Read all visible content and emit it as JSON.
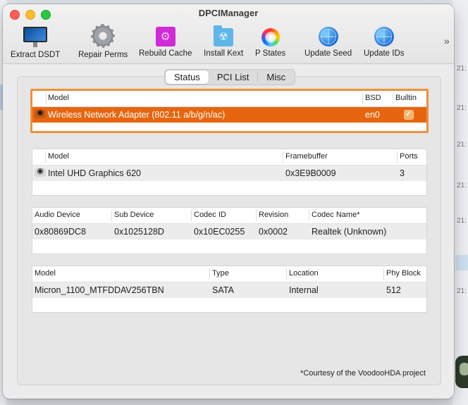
{
  "window": {
    "title": "DPCIManager"
  },
  "toolbar": [
    {
      "label": "Extract DSDT",
      "icon": "monitor-icon"
    },
    {
      "label": "Repair Perms",
      "icon": "gear-icon"
    },
    {
      "label": "Rebuild Cache",
      "icon": "cache-icon"
    },
    {
      "label": "Install Kext",
      "icon": "kext-folder-icon"
    },
    {
      "label": "P States",
      "icon": "color-wheel-icon"
    },
    {
      "label": "Update Seed",
      "icon": "globe-icon"
    },
    {
      "label": "Update IDs",
      "icon": "globe-icon"
    }
  ],
  "toolbar_overflow": "»",
  "tabs": [
    {
      "label": "Status",
      "active": true
    },
    {
      "label": "PCI List",
      "active": false
    },
    {
      "label": "Misc",
      "active": false
    }
  ],
  "network": {
    "headers": {
      "model": "Model",
      "bsd": "BSD",
      "builtin": "Builtin"
    },
    "rows": [
      {
        "model": "Wireless Network Adapter (802.11 a/b/g/n/ac)",
        "bsd": "en0",
        "builtin": true
      }
    ]
  },
  "graphics": {
    "headers": {
      "model": "Model",
      "framebuffer": "Framebuffer",
      "ports": "Ports"
    },
    "rows": [
      {
        "model": "Intel UHD Graphics 620",
        "framebuffer": "0x3E9B0009",
        "ports": "3"
      }
    ]
  },
  "audio": {
    "headers": {
      "audio_device": "Audio Device",
      "sub_device": "Sub Device",
      "codec_id": "Codec ID",
      "revision": "Revision",
      "codec_name": "Codec Name*"
    },
    "rows": [
      {
        "audio_device": "0x80869DC8",
        "sub_device": "0x1025128D",
        "codec_id": "0x10EC0255",
        "revision": "0x0002",
        "codec_name": "Realtek (Unknown)"
      }
    ]
  },
  "storage": {
    "headers": {
      "model": "Model",
      "type": "Type",
      "location": "Location",
      "phy_block": "Phy Block"
    },
    "rows": [
      {
        "model": "Micron_1100_MTFDDAV256TBN",
        "type": "SATA",
        "location": "Internal",
        "phy_block": "512"
      }
    ]
  },
  "footer_note": "*Courtesy of the VoodooHDA project",
  "background_times": [
    "21:",
    "21:",
    "21:",
    "21:",
    "21:",
    "21:"
  ],
  "colors": {
    "selection": "#e8650f",
    "selection_frame": "#f0903a"
  }
}
